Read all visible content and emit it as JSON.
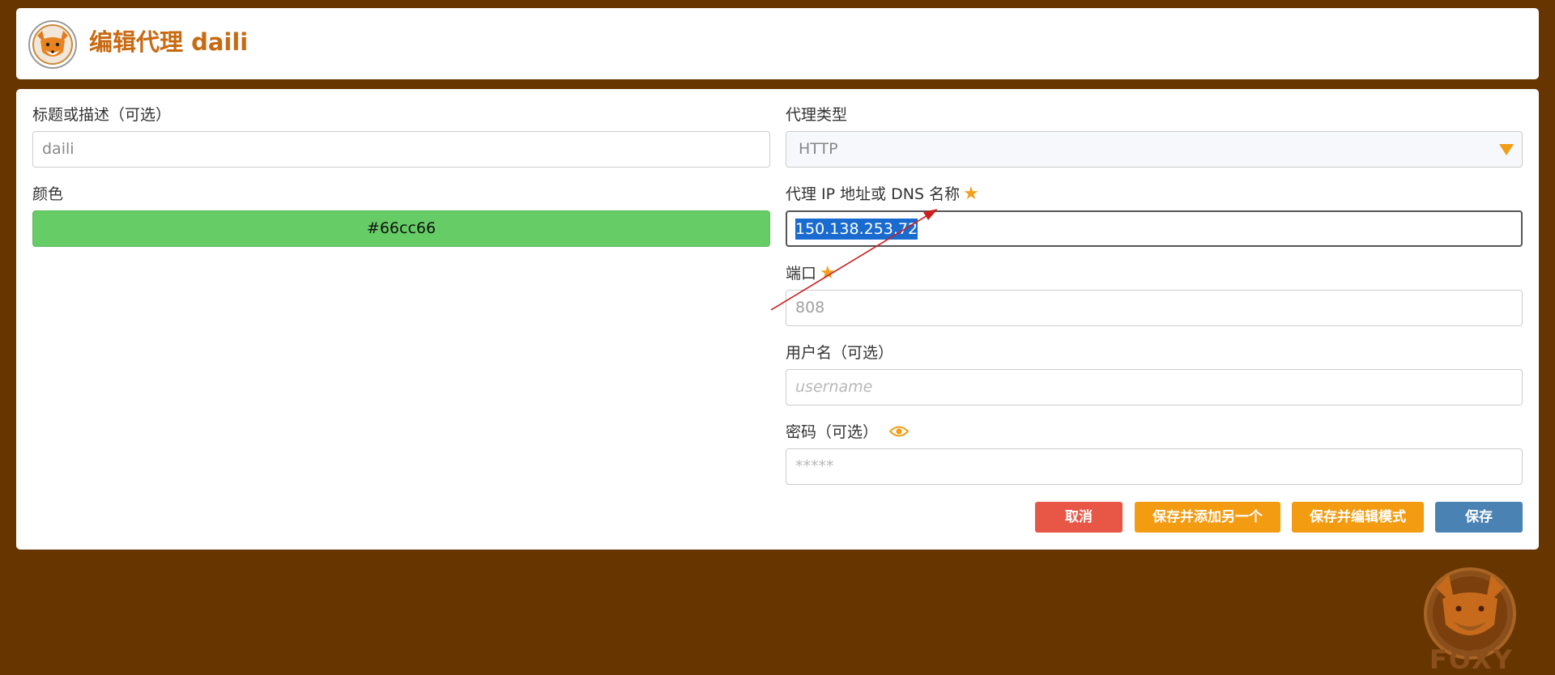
{
  "header": {
    "title": "编辑代理 daili",
    "logo_icon": "fox-logo-icon"
  },
  "form": {
    "title_field": {
      "label": "标题或描述（可选）",
      "value": "daili"
    },
    "color_field": {
      "label": "颜色",
      "value": "#66cc66"
    },
    "proxy_type": {
      "label": "代理类型",
      "value": "HTTP"
    },
    "proxy_host": {
      "label": "代理 IP 地址或 DNS 名称",
      "value": "150.138.253.72",
      "required_icon": "star-icon"
    },
    "port": {
      "label": "端口",
      "placeholder": "808",
      "required_icon": "star-icon"
    },
    "username": {
      "label": "用户名（可选）",
      "placeholder": "username"
    },
    "password": {
      "label": "密码（可选）",
      "placeholder": "*****",
      "toggle_icon": "eye-icon"
    }
  },
  "buttons": {
    "cancel": "取消",
    "save_add_another": "保存并添加另一个",
    "save_edit_mode": "保存并编辑模式",
    "save": "保存"
  },
  "colors": {
    "background": "#673500",
    "accent_orange": "#f39c12",
    "cancel_red": "#e85745",
    "save_blue": "#4a82b4",
    "title_orange": "#c86a12",
    "proxy_color": "#66cc66",
    "selection_blue": "#1a6bd0",
    "annotation_arrow": "#cc1f1f"
  },
  "watermark": {
    "text": "FOXY",
    "icon": "fox-logo-icon"
  }
}
